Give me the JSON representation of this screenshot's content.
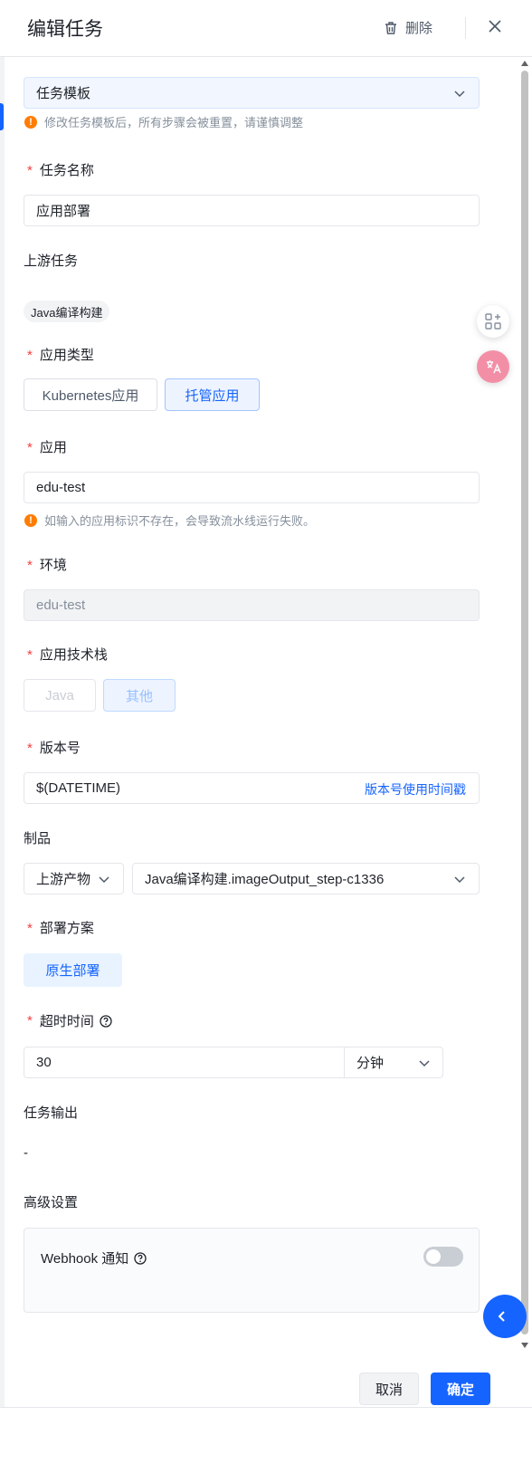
{
  "header": {
    "title": "编辑任务",
    "delete_label": "删除"
  },
  "template": {
    "value": "任务模板",
    "warning": "修改任务模板后，所有步骤会被重置，请谨慎调整"
  },
  "task_name": {
    "label": "任务名称",
    "value": "应用部署"
  },
  "upstream": {
    "label": "上游任务",
    "tag": "Java编译构建"
  },
  "app_type": {
    "label": "应用类型",
    "options": [
      "Kubernetes应用",
      "托管应用"
    ],
    "selected": "托管应用"
  },
  "app": {
    "label": "应用",
    "value": "edu-test",
    "warning": "如输入的应用标识不存在，会导致流水线运行失败。"
  },
  "env": {
    "label": "环境",
    "value": "edu-test"
  },
  "tech_stack": {
    "label": "应用技术栈",
    "options": [
      "Java",
      "其他"
    ],
    "selected": "其他"
  },
  "version": {
    "label": "版本号",
    "value": "$(DATETIME)",
    "link": "版本号使用时间戳"
  },
  "artifact": {
    "label": "制品",
    "source": "上游产物",
    "value": "Java编译构建.imageOutput_step-c1336"
  },
  "deploy": {
    "label": "部署方案",
    "option": "原生部署"
  },
  "timeout": {
    "label": "超时时间",
    "value": "30",
    "unit": "分钟"
  },
  "output": {
    "label": "任务输出",
    "value": "-"
  },
  "advanced": {
    "label": "高级设置",
    "webhook_label": "Webhook 通知",
    "webhook_enabled": false
  },
  "footer": {
    "cancel": "取消",
    "confirm": "确定"
  },
  "colors": {
    "primary": "#1664ff",
    "required": "#f53f3f",
    "warning": "#ff7d00"
  }
}
